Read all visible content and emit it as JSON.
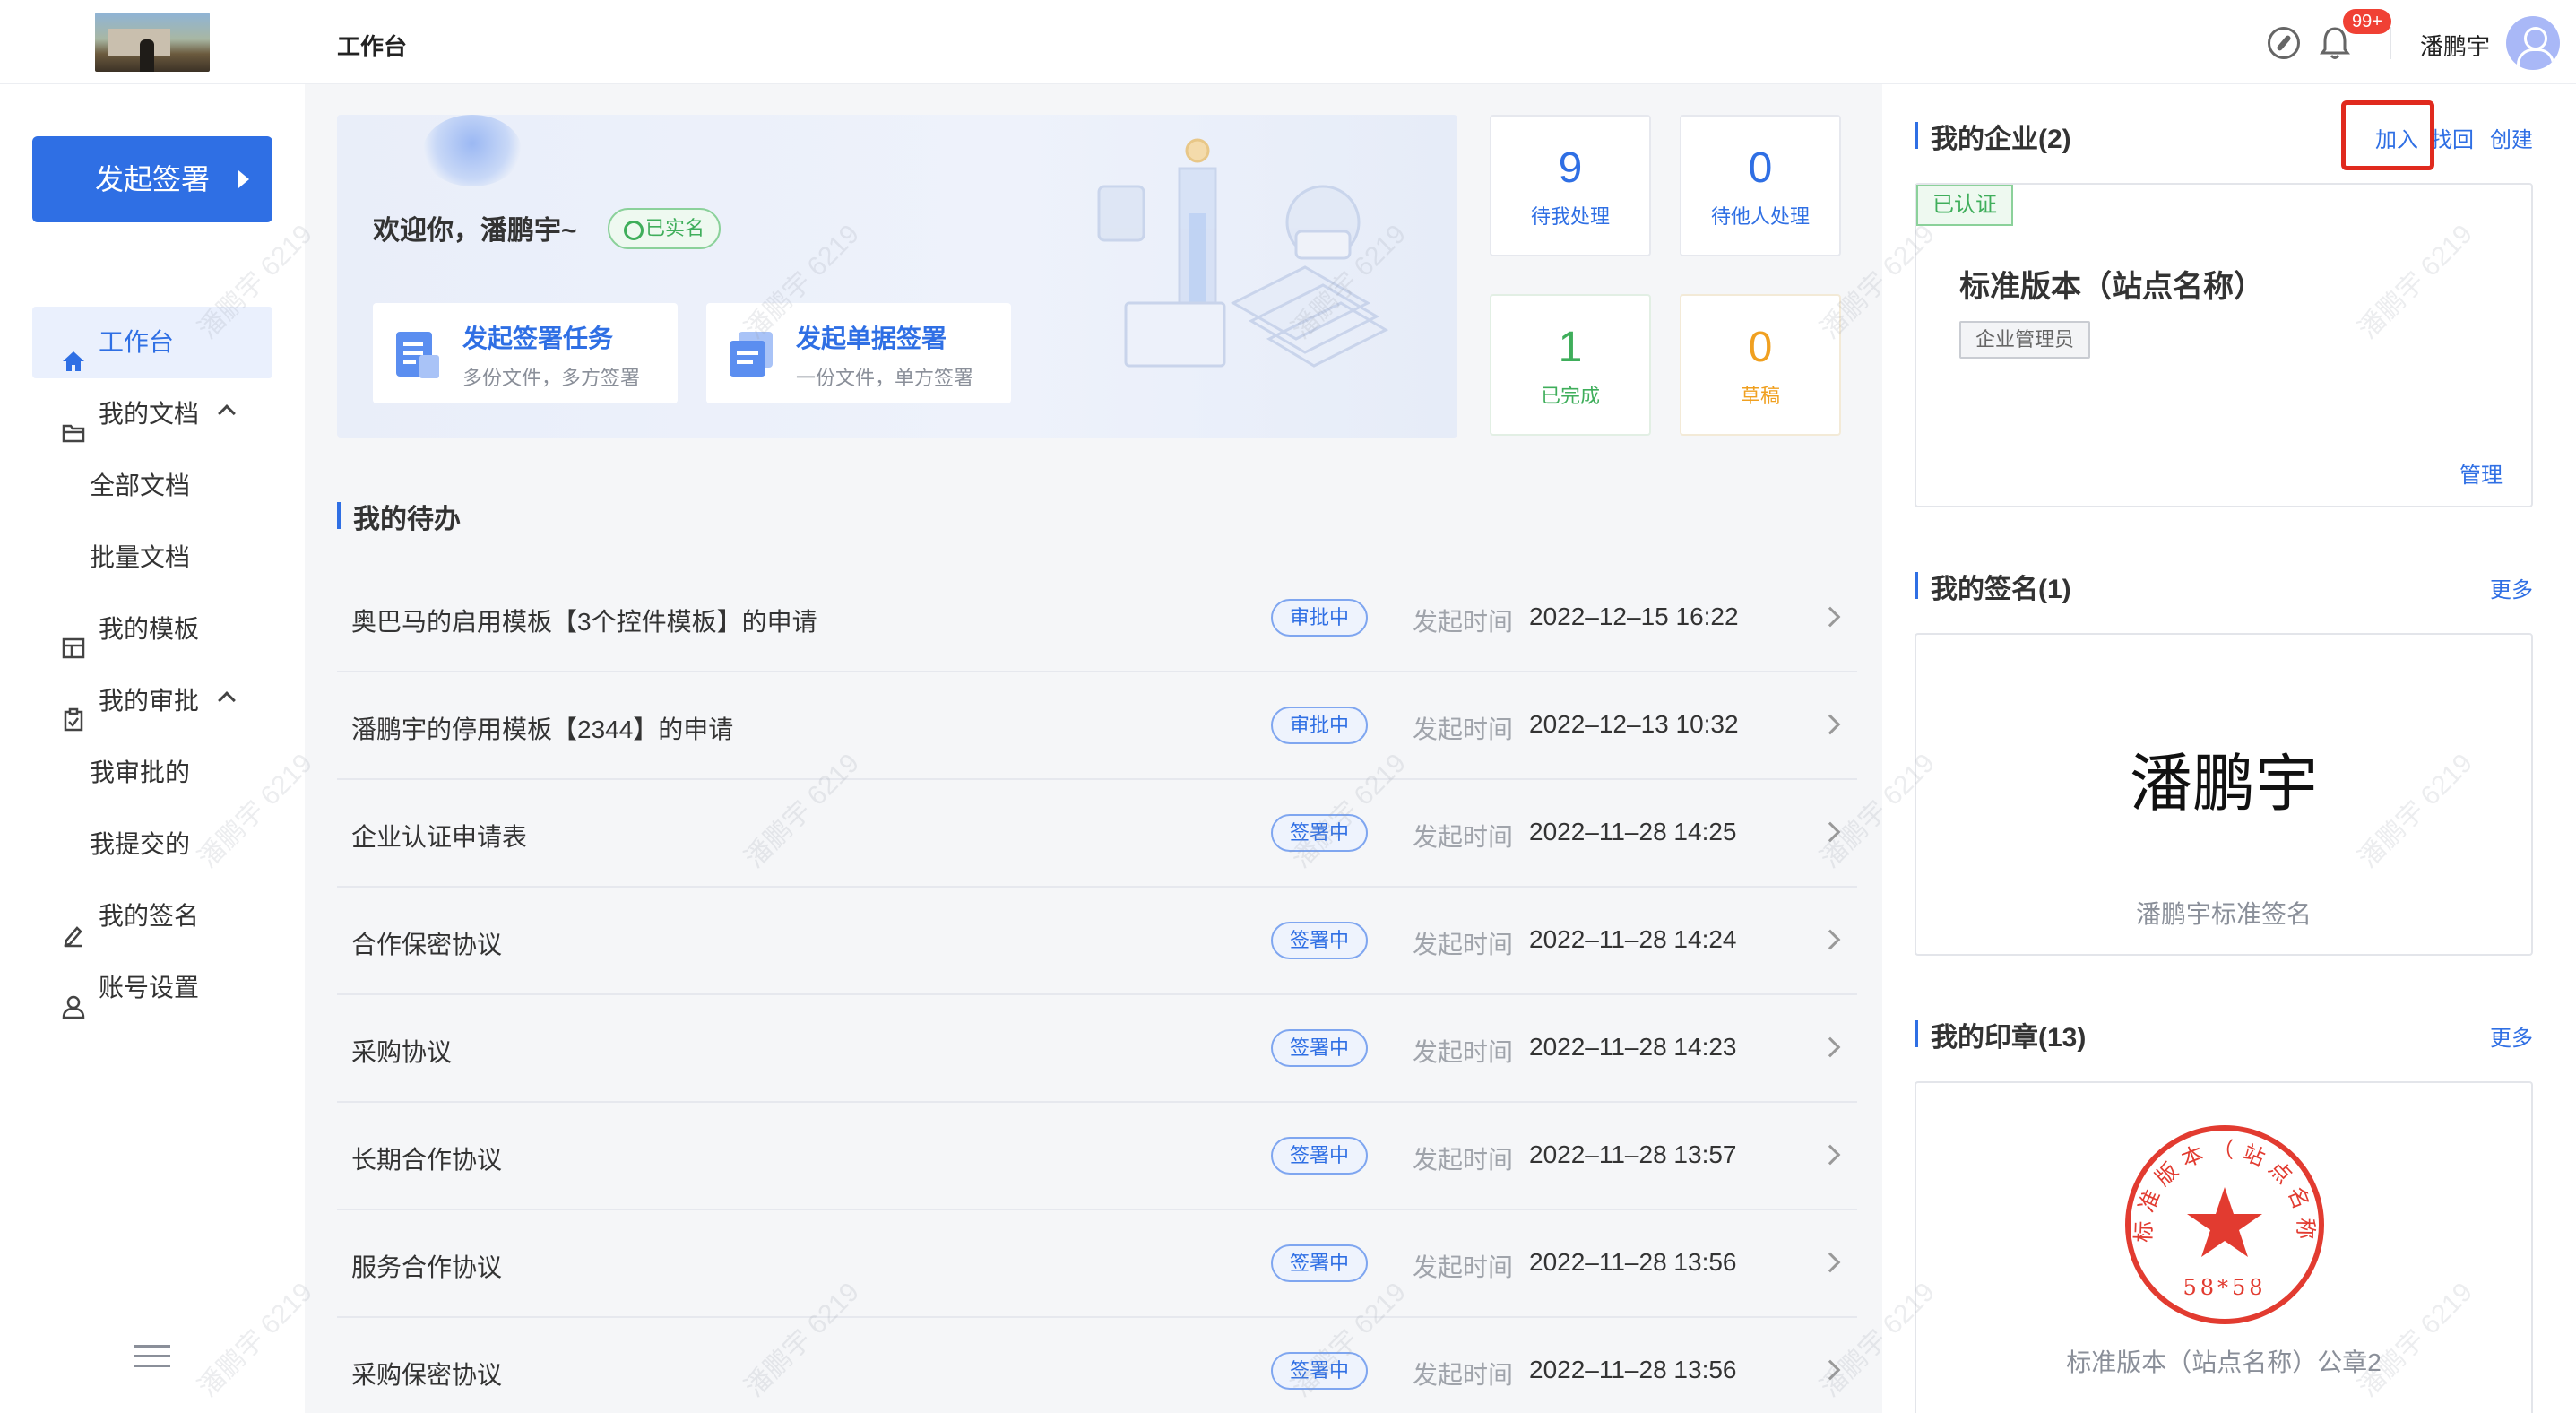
{
  "header": {
    "title": "工作台",
    "notification_badge": "99+",
    "user_name": "潘鹏宇"
  },
  "sidebar": {
    "start_button": "发起签署",
    "items": [
      {
        "label": "工作台",
        "icon": "home-icon"
      },
      {
        "label": "我的文档",
        "icon": "folder-icon"
      },
      {
        "label": "全部文档"
      },
      {
        "label": "批量文档"
      },
      {
        "label": "我的模板",
        "icon": "template-icon"
      },
      {
        "label": "我的审批",
        "icon": "clipboard-icon"
      },
      {
        "label": "我审批的"
      },
      {
        "label": "我提交的"
      },
      {
        "label": "我的签名",
        "icon": "pen-icon"
      },
      {
        "label": "账号设置",
        "icon": "user-icon"
      }
    ]
  },
  "welcome": {
    "greeting": "欢迎你，潘鹏宇~",
    "verified": "已实名",
    "actions": [
      {
        "title": "发起签署任务",
        "desc": "多份文件，多方签署"
      },
      {
        "title": "发起单据签署",
        "desc": "一份文件，单方签署"
      }
    ]
  },
  "stats": [
    {
      "num": "9",
      "label": "待我处理",
      "color": "#2f6fe4"
    },
    {
      "num": "0",
      "label": "待他人处理",
      "color": "#2f6fe4"
    },
    {
      "num": "1",
      "label": "已完成",
      "color": "#3fae5b"
    },
    {
      "num": "0",
      "label": "草稿",
      "color": "#f0a020"
    }
  ],
  "todo": {
    "title": "我的待办",
    "time_label": "发起时间",
    "rows": [
      {
        "name": "奥巴马的启用模板【3个控件模板】的申请",
        "status": "审批中",
        "time": "2022–12–15 16:22"
      },
      {
        "name": "潘鹏宇的停用模板【2344】的申请",
        "status": "审批中",
        "time": "2022–12–13 10:32"
      },
      {
        "name": "企业认证申请表",
        "status": "签署中",
        "time": "2022–11–28 14:25"
      },
      {
        "name": "合作保密协议",
        "status": "签署中",
        "time": "2022–11–28 14:24"
      },
      {
        "name": "采购协议",
        "status": "签署中",
        "time": "2022–11–28 14:23"
      },
      {
        "name": "长期合作协议",
        "status": "签署中",
        "time": "2022–11–28 13:57"
      },
      {
        "name": "服务合作协议",
        "status": "签署中",
        "time": "2022–11–28 13:56"
      },
      {
        "name": "采购保密协议",
        "status": "签署中",
        "time": "2022–11–28 13:56"
      }
    ]
  },
  "enterprise": {
    "title": "我的企业(2)",
    "links": [
      "加入",
      "找回",
      "创建"
    ],
    "tag": "已认证",
    "name": "标准版本（站点名称）",
    "role": "企业管理员",
    "manage": "管理"
  },
  "signature": {
    "title": "我的签名(1)",
    "more": "更多",
    "text": "潘鹏宇",
    "name": "潘鹏宇标准签名"
  },
  "seal": {
    "title": "我的印章(13)",
    "more": "更多",
    "seal_text": "标准版本（站点名称）",
    "seal_code": "58*58",
    "name": "标准版本（站点名称）公章2"
  },
  "watermark": "潘鹏宇 6219",
  "colors": {
    "accent": "#2f6fe4",
    "success": "#3fae5b",
    "warning": "#f0a020",
    "highlight": "#e02a1e"
  }
}
